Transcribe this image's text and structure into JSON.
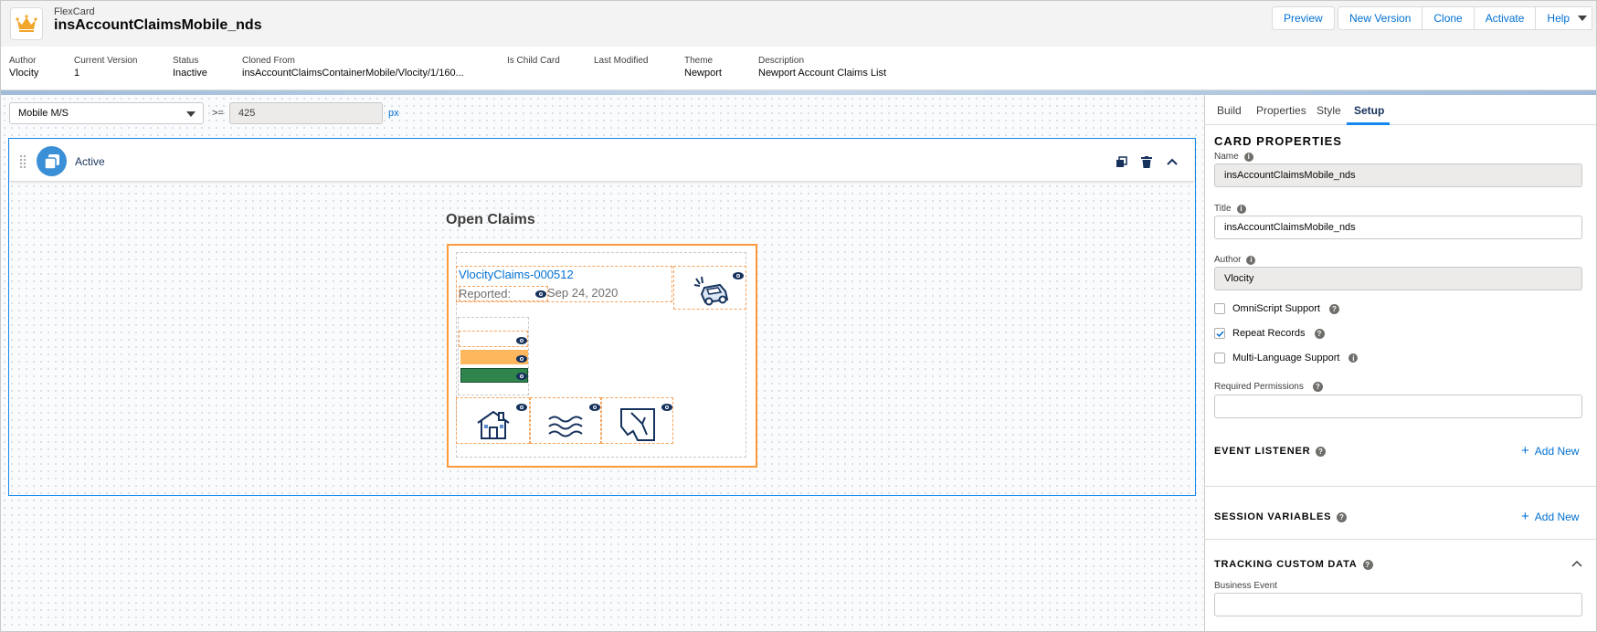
{
  "header": {
    "subtitle": "FlexCard",
    "title": "insAccountClaimsMobile_nds",
    "buttons": {
      "preview": "Preview",
      "new_version": "New Version",
      "clone": "Clone",
      "activate": "Activate",
      "help": "Help"
    }
  },
  "meta": [
    {
      "label": "Author",
      "value": "Vlocity"
    },
    {
      "label": "Current Version",
      "value": "1"
    },
    {
      "label": "Status",
      "value": "Inactive"
    },
    {
      "label": "Cloned From",
      "value": "insAccountClaimsContainerMobile/Vlocity/1/160..."
    },
    {
      "label": "Is Child Card",
      "value": ""
    },
    {
      "label": "Last Modified",
      "value": ""
    },
    {
      "label": "Theme",
      "value": "Newport"
    },
    {
      "label": "Description",
      "value": "Newport Account Claims List"
    }
  ],
  "canvas": {
    "breakpoint_select": "Mobile M/S",
    "operator": ">=",
    "width_value": "425",
    "unit": "px",
    "state_label": "Active",
    "card_heading": "Open Claims",
    "claim_link": "VlocityClaims-000512",
    "reported_label": "Reported:",
    "reported_date": "Sep 24, 2020",
    "icons": [
      "car-crash-icon",
      "house-icon",
      "water-icon",
      "broken-window-icon"
    ]
  },
  "panel": {
    "tabs": [
      "Build",
      "Properties",
      "Style",
      "Setup"
    ],
    "active_tab": "Setup",
    "section_title": "CARD PROPERTIES",
    "name_label": "Name",
    "name_value": "insAccountClaimsMobile_nds",
    "title_label": "Title",
    "title_value": "insAccountClaimsMobile_nds",
    "author_label": "Author",
    "author_value": "Vlocity",
    "omniscript_label": "OmniScript Support",
    "omniscript_checked": false,
    "repeat_label": "Repeat Records",
    "repeat_checked": true,
    "multilang_label": "Multi-Language Support",
    "multilang_checked": false,
    "permissions_label": "Required Permissions",
    "permissions_value": "",
    "event_listener": "EVENT LISTENER",
    "session_variables": "SESSION VARIABLES",
    "tracking_custom_data": "TRACKING CUSTOM DATA",
    "add_new": "Add New",
    "business_event_label": "Business Event",
    "business_event_value": ""
  },
  "colors": {
    "brand_blue": "#0070d2",
    "state_border": "#1589ee",
    "card_border": "#ff9a3c",
    "orange_bar": "#ffb75d",
    "green_bar": "#2e844a"
  }
}
